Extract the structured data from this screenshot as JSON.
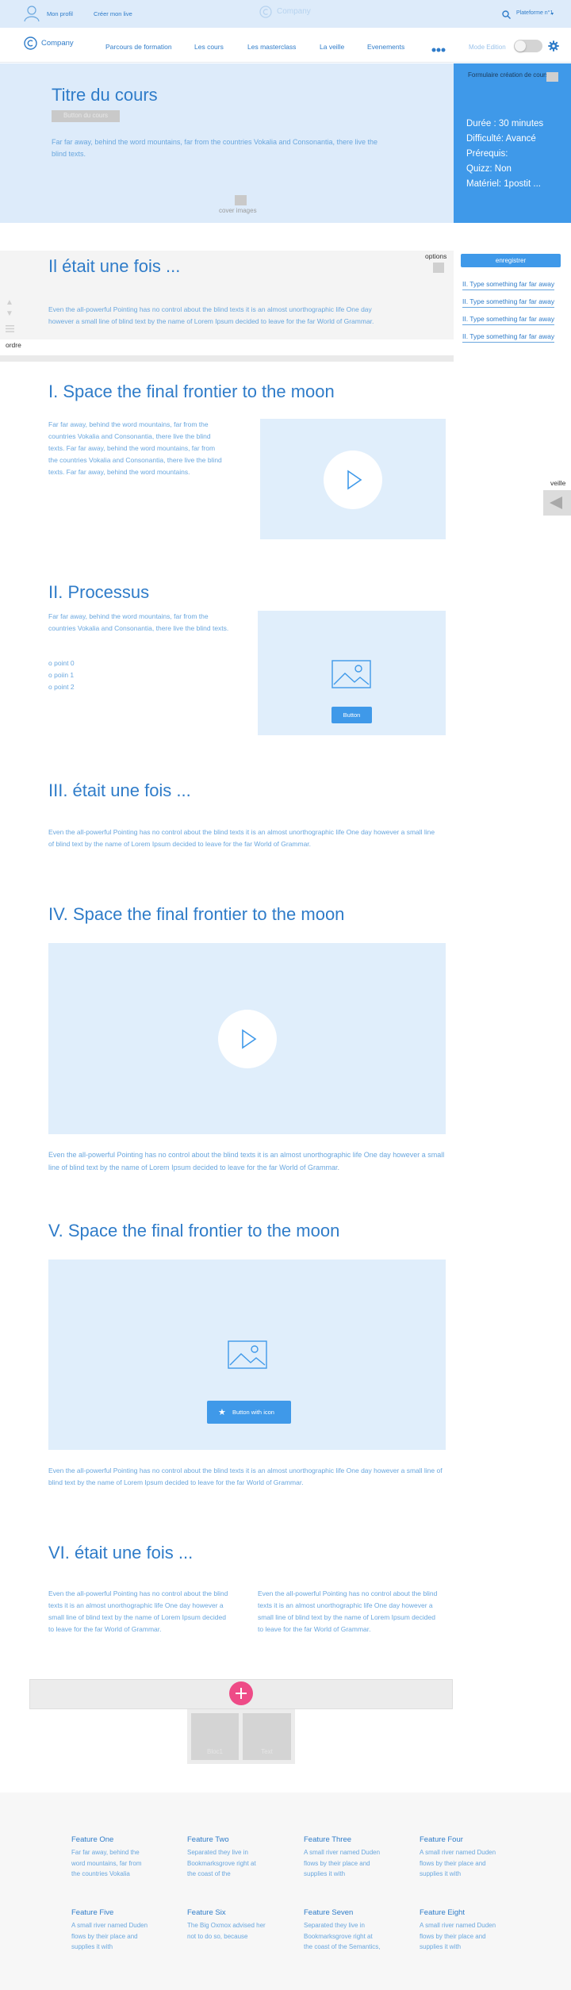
{
  "topbar": {
    "profile_label": "Mon profil",
    "create_label": "Créer mon live",
    "logo_label": "Company",
    "platform_label": "Plateforme n°1"
  },
  "navbar": {
    "brand": "Company",
    "links": [
      "Parcours de formation",
      "Les cours",
      "Les masterclass",
      "La veille",
      "Evenements"
    ],
    "mode_label": "Mode Edition"
  },
  "hero": {
    "title": "Titre du cours",
    "subtitle_button": "Button du cours",
    "description": "Far far away, behind the word mountains, far from the countries Vokalia and Consonantia, there live the blind texts.",
    "cover_label": "cover images",
    "side": {
      "form_title": "Formulaire création de cours",
      "duration": "Durée : 30 minutes",
      "difficulty": "Difficulté: Avancé",
      "prereq": "Prérequis:",
      "quiz": "Quizz: Non",
      "material": "Matériel: 1postit ..."
    }
  },
  "story": {
    "options_label": "options",
    "title": "Il était une fois ...",
    "text": "Even the all-powerful Pointing has no control about the blind texts it is an almost unorthographic life One day however a small line of blind text by the name of Lorem Ipsum decided to leave for the far World of Grammar.",
    "order_label": "ordre",
    "save_label": "enregistrer",
    "side_links": [
      "II. Type something far far away",
      "II. Type something far far away",
      "II. Type something far far away",
      "II. Type something far far away"
    ]
  },
  "veille_label": "veille",
  "sections": {
    "s1": {
      "title": "I. Space the final frontier to the moon",
      "text": "Far far away, behind the word mountains, far from the countries Vokalia and Consonantia, there live the blind texts. Far far away, behind the word mountains, far from the countries Vokalia and Consonantia, there live the blind texts. Far far away, behind the word mountains."
    },
    "s2": {
      "title": "II. Processus",
      "text": "Far far away, behind the word mountains, far from the countries Vokalia and Consonantia, there live the blind texts.",
      "points": [
        "o point 0",
        "o poiin 1",
        "o point 2"
      ],
      "button": "Button"
    },
    "s3": {
      "title": "III. était une fois ...",
      "text": "Even the all-powerful Pointing has no control about the blind texts it is an almost unorthographic life One day however a small line of blind text by the name of Lorem Ipsum decided to leave for the far World of Grammar."
    },
    "s4": {
      "title": "IV. Space the final frontier to the moon",
      "text": "Even the all-powerful Pointing has no control about the blind texts it is an almost unorthographic life One day however a small line of blind text by the name of Lorem Ipsum decided to leave for the far World of Grammar."
    },
    "s5": {
      "title": "V. Space the final frontier to the moon",
      "button": "Button with icon",
      "text": "Even the all-powerful Pointing has no control about the blind texts it is an almost unorthographic life One day however a small line of blind text by the name of Lorem Ipsum decided to leave for the far World of Grammar."
    },
    "s6": {
      "title": "VI. était une fois ...",
      "col1": "Even the all-powerful Pointing has no control about the blind texts it is an almost unorthographic life One day however a small line of blind text by the name of Lorem Ipsum decided to leave for the far World of Grammar.",
      "col2": "Even the all-powerful Pointing has no control about the blind texts it is an almost unorthographic life One day however a small line of blind text by the name of Lorem Ipsum decided to leave for the far World of Grammar."
    }
  },
  "add_block": {
    "tile1": "Bloc1",
    "tile2": "Text"
  },
  "footer": {
    "features": [
      {
        "title": "Feature One",
        "text": "Far far away, behind the word mountains, far from the countries Vokalia"
      },
      {
        "title": "Feature Two",
        "text": "Separated they live in Bookmarksgrove right at the coast of the"
      },
      {
        "title": "Feature Three",
        "text": "A small river named Duden flows by their place and supplies it with"
      },
      {
        "title": "Feature Four",
        "text": "A small river named Duden flows by their place and supplies it with"
      },
      {
        "title": "Feature Five",
        "text": "A small river named Duden flows by their place and supplies it with"
      },
      {
        "title": "Feature Six",
        "text": "The Big Oxmox advised her not to do so, because"
      },
      {
        "title": "Feature Seven",
        "text": "Separated they live in Bookmarksgrove right at the coast of the Semantics,"
      },
      {
        "title": "Feature Eight",
        "text": "A small river named Duden flows by their place and supplies it with"
      }
    ]
  },
  "colors": {
    "accent": "#3f99e9",
    "text": "#2f7cc9",
    "panel": "#e0eefb",
    "fab": "#ee4b87"
  }
}
